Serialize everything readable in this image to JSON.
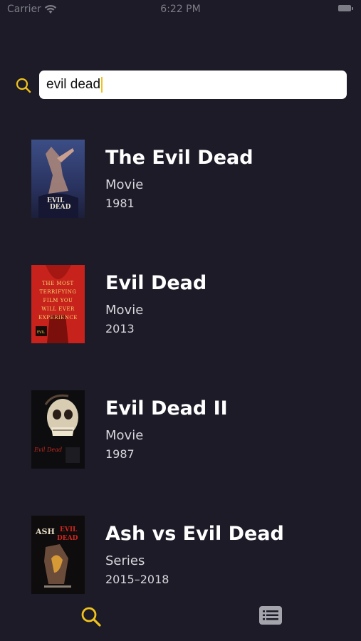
{
  "status_bar": {
    "carrier": "Carrier",
    "time": "6:22 PM"
  },
  "search": {
    "query": "evil dead",
    "icon": "search-icon"
  },
  "colors": {
    "background": "#1c1b27",
    "accent": "#f0c31c",
    "text": "#ffffff",
    "subtext": "#d7d7dc"
  },
  "results": [
    {
      "title": "The Evil Dead",
      "kind": "Movie",
      "year": "1981"
    },
    {
      "title": "Evil Dead",
      "kind": "Movie",
      "year": "2013",
      "poster_text": "THE MOST TERRIFYING FILM YOU WILL EVER EXPERIENCE"
    },
    {
      "title": "Evil Dead II",
      "kind": "Movie",
      "year": "1987"
    },
    {
      "title": "Ash vs Evil Dead",
      "kind": "Series",
      "year": "2015–2018"
    }
  ],
  "tab_bar": {
    "tabs": [
      {
        "icon": "search-icon",
        "selected": true
      },
      {
        "icon": "list-icon",
        "selected": false
      }
    ]
  }
}
